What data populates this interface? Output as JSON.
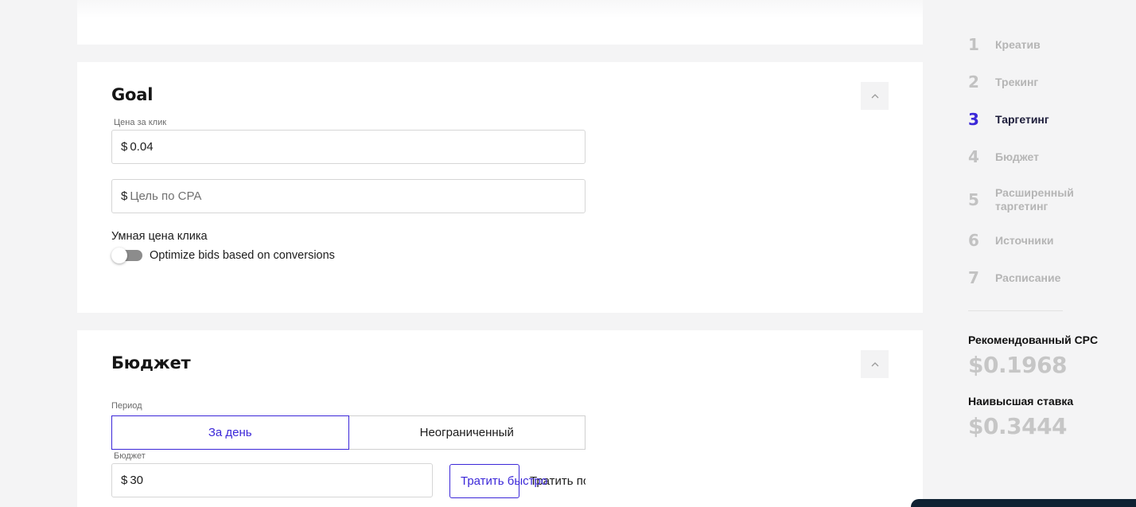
{
  "goal": {
    "title": "Goal",
    "cpc_label": "Цена за клик",
    "cpc_currency": "$",
    "cpc_value": "0.04",
    "cpa_currency": "$",
    "cpa_placeholder": "Цель по CPA",
    "smart_label": "Умная цена клика",
    "toggle_label": "Optimize bids based on conversions",
    "toggle_on": false
  },
  "budget": {
    "title": "Бюджет",
    "period_label": "Период",
    "period_options": [
      "За день",
      "Неограниченный"
    ],
    "period_selected": "За день",
    "budget_label": "Бюджет",
    "budget_currency": "$",
    "budget_value": "30",
    "spend_fast": "Тратить быстро",
    "spend_even": "Тратить по"
  },
  "steps": [
    {
      "num": "1",
      "label": "Креатив"
    },
    {
      "num": "2",
      "label": "Трекинг"
    },
    {
      "num": "3",
      "label": "Таргетинг",
      "active": true
    },
    {
      "num": "4",
      "label": "Бюджет"
    },
    {
      "num": "5",
      "label_line1": "Расширенный",
      "label_line2": "таргетинг"
    },
    {
      "num": "6",
      "label": "Источники"
    },
    {
      "num": "7",
      "label": "Расписание"
    }
  ],
  "recommendation": {
    "cpc_label": "Рекомендованный CPC",
    "cpc_value": "$0.1968",
    "max_label": "Наивысшая ставка",
    "max_value": "$0.3444"
  },
  "colors": {
    "accent": "#3b27d8",
    "muted": "#c6c6c6",
    "background": "#f4f4f5"
  }
}
